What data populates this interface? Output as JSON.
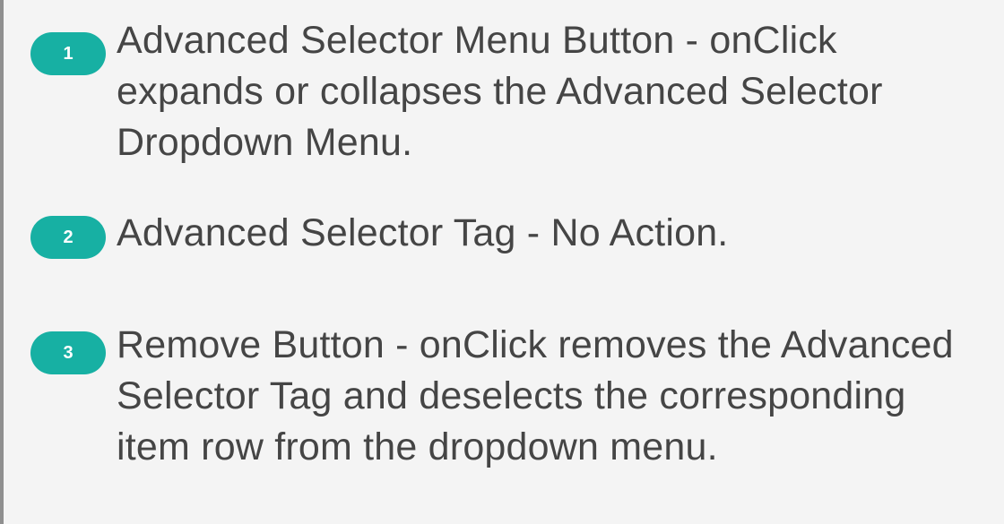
{
  "items": [
    {
      "number": "1",
      "text": "Advanced Selector Menu Button - onClick expands or collapses the Advanced Selector Dropdown Menu."
    },
    {
      "number": "2",
      "text": "Advanced Selector Tag - No Action."
    },
    {
      "number": "3",
      "text": "Remove Button - onClick removes the Advanced Selector Tag and deselects the corresponding item row from the dropdown menu."
    }
  ],
  "colors": {
    "background": "#f4f4f4",
    "text": "#454545",
    "badge": "#17b0a3",
    "badge_text": "#ffffff",
    "left_rule": "#8f8f8f"
  }
}
